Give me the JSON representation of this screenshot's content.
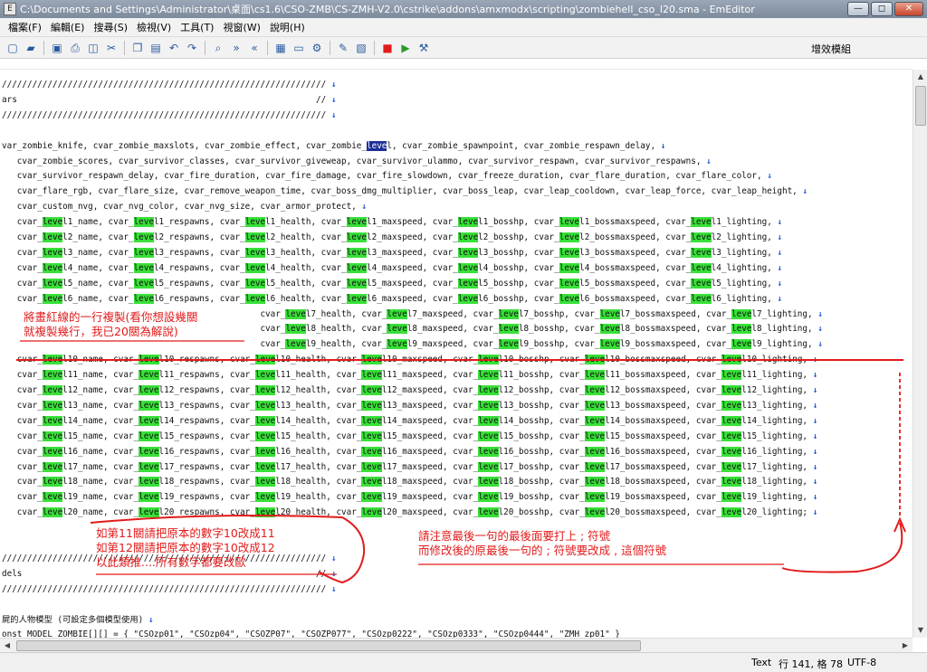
{
  "window": {
    "title": "C:\\Documents and Settings\\Administrator\\桌面\\cs1.6\\CSO-ZMB\\CS-ZMH-V2.0\\cstrike\\addons\\amxmodx\\scripting\\zombiehell_cso_l20.sma - EmEditor"
  },
  "menu": [
    "檔案(F)",
    "編輯(E)",
    "搜尋(S)",
    "檢視(V)",
    "工具(T)",
    "視窗(W)",
    "說明(H)"
  ],
  "toolbar": {
    "plugin_label": "增效模組"
  },
  "icons": {
    "window_controls": [
      "minimize-icon",
      "maximize-icon",
      "close-icon"
    ],
    "toolbar": [
      "new-file-icon",
      "open-folder-icon",
      "save-icon",
      "print-icon",
      "print-preview-icon",
      "cut-icon",
      "copy-icon",
      "paste-icon",
      "undo-icon",
      "redo-icon",
      "find-icon",
      "find-next-icon",
      "find-prev-icon",
      "wrap-icon",
      "window-icon",
      "config-icon",
      "tools-icon",
      "macro-icon",
      "stop-icon",
      "play-icon",
      "plugin-icon"
    ]
  },
  "colors": {
    "highlight": "#38e038",
    "annotation": "#e21b1b",
    "eol_arrow": "#1a55d8",
    "selection": "#1c2f99"
  },
  "code_lines": [
    "////////////////////////////////////////////////////////////////",
    "ars                                                           //",
    "////////////////////////////////////////////////////////////////",
    "",
    "var_zombie_knife, cvar_zombie_maxslots, cvar_zombie_effect, cvar_zombie_level, cvar_zombie_spawnpoint, cvar_zombie_respawn_delay,",
    "   cvar_zombie_scores, cvar_survivor_classes, cvar_survivor_giveweap, cvar_survivor_ulammo, cvar_survivor_respawn, cvar_survivor_respawns,",
    "   cvar_survivor_respawn_delay, cvar_fire_duration, cvar_fire_damage, cvar_fire_slowdown, cvar_freeze_duration, cvar_flare_duration, cvar_flare_color,",
    "   cvar_flare_rgb, cvar_flare_size, cvar_remove_weapon_time, cvar_boss_dmg_multiplier, cvar_boss_leap, cvar_leap_cooldown, cvar_leap_force, cvar_leap_height,",
    "   cvar_custom_nvg, cvar_nvg_color, cvar_nvg_size, cvar_armor_protect,",
    "   cvar_level1_name, cvar_level1_respawns, cvar_level1_health, cvar_level1_maxspeed, cvar_level1_bosshp, cvar_level1_bossmaxspeed, cvar_level1_lighting,",
    "   cvar_level2_name, cvar_level2_respawns, cvar_level2_health, cvar_level2_maxspeed, cvar_level2_bosshp, cvar_level2_bossmaxspeed, cvar_level2_lighting,",
    "   cvar_level3_name, cvar_level3_respawns, cvar_level3_health, cvar_level3_maxspeed, cvar_level3_bosshp, cvar_level3_bossmaxspeed, cvar_level3_lighting,",
    "   cvar_level4_name, cvar_level4_respawns, cvar_level4_health, cvar_level4_maxspeed, cvar_level4_bosshp, cvar_level4_bossmaxspeed, cvar_level4_lighting,",
    "   cvar_level5_name, cvar_level5_respawns, cvar_level5_health, cvar_level5_maxspeed, cvar_level5_bosshp, cvar_level5_bossmaxspeed, cvar_level5_lighting,",
    "   cvar_level6_name, cvar_level6_respawns, cvar_level6_health, cvar_level6_maxspeed, cvar_level6_bosshp, cvar_level6_bossmaxspeed, cvar_level6_lighting,",
    "                                                   cvar_level7_health, cvar_level7_maxspeed, cvar_level7_bosshp, cvar_level7_bossmaxspeed, cvar_level7_lighting,",
    "                                                   cvar_level8_health, cvar_level8_maxspeed, cvar_level8_bosshp, cvar_level8_bossmaxspeed, cvar_level8_lighting,",
    "                                                   cvar_level9_health, cvar_level9_maxspeed, cvar_level9_bosshp, cvar_level9_bossmaxspeed, cvar_level9_lighting,",
    "   cvar_level10_name, cvar_level10_respawns, cvar_level10_health, cvar_level10_maxspeed, cvar_level10_bosshp, cvar_level10_bossmaxspeed, cvar_level10_lighting,",
    "   cvar_level11_name, cvar_level11_respawns, cvar_level11_health, cvar_level11_maxspeed, cvar_level11_bosshp, cvar_level11_bossmaxspeed, cvar_level11_lighting,",
    "   cvar_level12_name, cvar_level12_respawns, cvar_level12_health, cvar_level12_maxspeed, cvar_level12_bosshp, cvar_level12_bossmaxspeed, cvar_level12_lighting,",
    "   cvar_level13_name, cvar_level13_respawns, cvar_level13_health, cvar_level13_maxspeed, cvar_level13_bosshp, cvar_level13_bossmaxspeed, cvar_level13_lighting,",
    "   cvar_level14_name, cvar_level14_respawns, cvar_level14_health, cvar_level14_maxspeed, cvar_level14_bosshp, cvar_level14_bossmaxspeed, cvar_level14_lighting,",
    "   cvar_level15_name, cvar_level15_respawns, cvar_level15_health, cvar_level15_maxspeed, cvar_level15_bosshp, cvar_level15_bossmaxspeed, cvar_level15_lighting,",
    "   cvar_level16_name, cvar_level16_respawns, cvar_level16_health, cvar_level16_maxspeed, cvar_level16_bosshp, cvar_level16_bossmaxspeed, cvar_level16_lighting,",
    "   cvar_level17_name, cvar_level17_respawns, cvar_level17_health, cvar_level17_maxspeed, cvar_level17_bosshp, cvar_level17_bossmaxspeed, cvar_level17_lighting,",
    "   cvar_level18_name, cvar_level18_respawns, cvar_level18_health, cvar_level18_maxspeed, cvar_level18_bosshp, cvar_level18_bossmaxspeed, cvar_level18_lighting,",
    "   cvar_level19_name, cvar_level19_respawns, cvar_level19_health, cvar_level19_maxspeed, cvar_level19_bosshp, cvar_level19_bossmaxspeed, cvar_level19_lighting,",
    "   cvar_level20_name, cvar_level20_respawns, cvar_level20_health, cvar_level20_maxspeed, cvar_level20_bosshp, cvar_level20_bossmaxspeed, cvar_level20_lighting;",
    "",
    "",
    "////////////////////////////////////////////////////////////////",
    "dels                                                          //",
    "////////////////////////////////////////////////////////////////",
    "",
    "屍的人物模型 (可設定多個模型使用)",
    "onst MODEL_ZOMBIE[][] = { \"CSOzp01\", \"CSOzp04\", \"CSOZP07\", \"CSOZP077\", \"CSOzp0222\", \"CSOzp0333\", \"CSOzp0444\", \"ZMH_zp01\" }"
  ],
  "eol_flags": [
    1,
    1,
    1,
    0,
    1,
    1,
    1,
    1,
    1,
    1,
    1,
    1,
    1,
    1,
    1,
    1,
    1,
    1,
    1,
    1,
    1,
    1,
    1,
    1,
    1,
    1,
    1,
    1,
    1,
    0,
    0,
    1,
    1,
    1,
    0,
    1,
    0
  ],
  "highlight_word": "leve",
  "annotations": {
    "copy_note": [
      "將畫紅線的一行複製(看你想設幾關",
      "就複製幾行，我已20關為解說)"
    ],
    "number_note": [
      "如第11關請把原本的數字10改成11",
      "如第12關請把原本的數字10改成12",
      "以此類推....所有數字都要改歐"
    ],
    "semicolon_note": [
      "請注意最後一句的最後面要打上 ; 符號",
      "而修改後的原最後一句的 ; 符號要改成 , 這個符號"
    ]
  },
  "status": {
    "mode": "Text",
    "position": "行 141, 格 78",
    "encoding": "UTF-8"
  }
}
